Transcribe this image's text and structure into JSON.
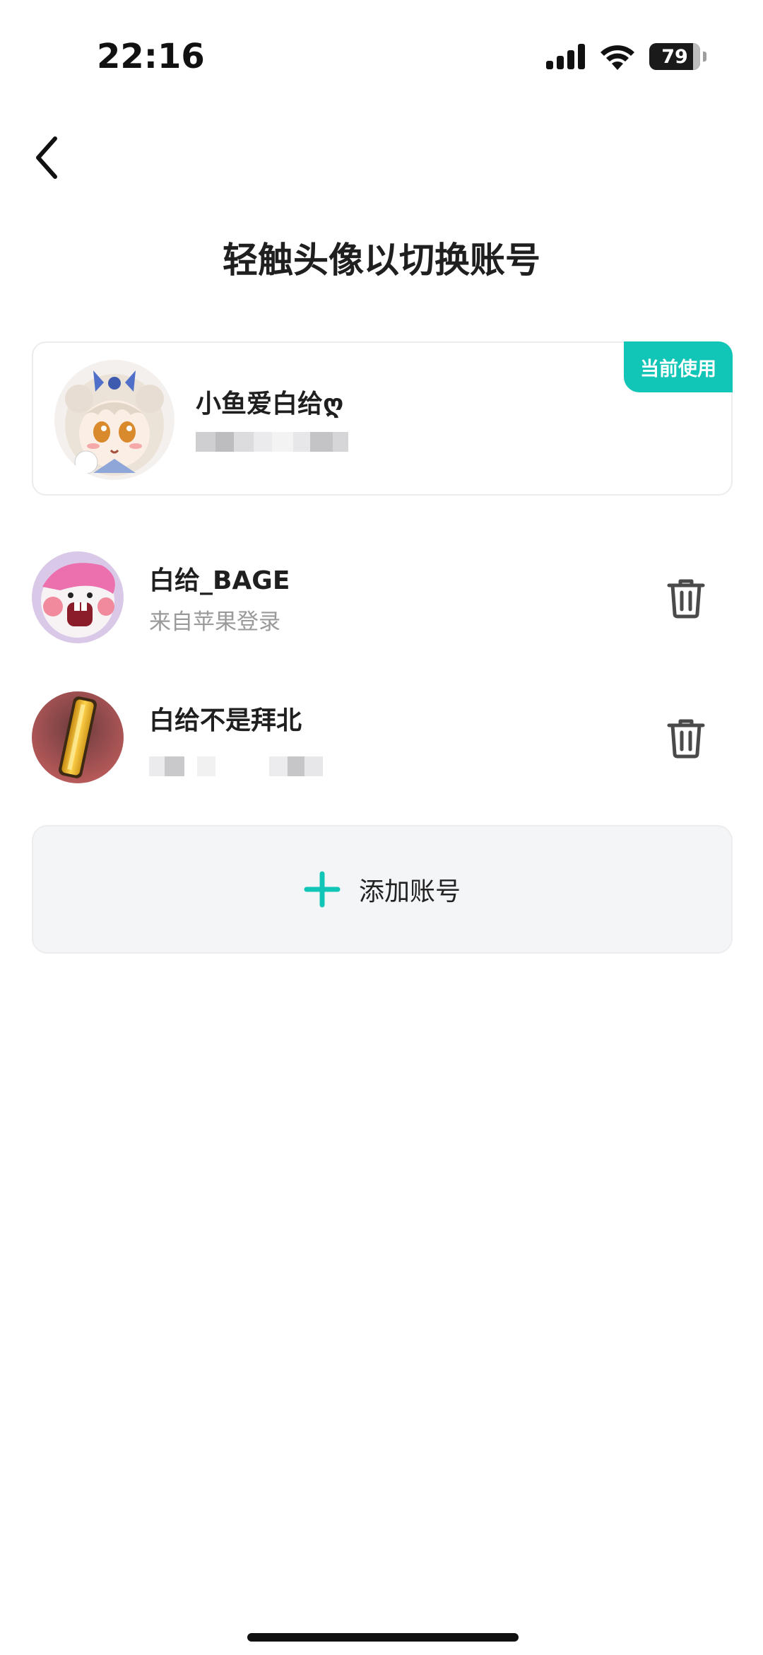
{
  "status_bar": {
    "time": "22:16",
    "battery": "79",
    "icons": [
      "cellular-signal-icon",
      "wifi-icon",
      "battery-icon"
    ]
  },
  "nav": {
    "back_icon": "chevron-left-icon"
  },
  "page": {
    "title": "轻触头像以切换账号"
  },
  "current_account": {
    "badge": "当前使用",
    "name": "小鱼爱白给ღ",
    "avatar_description_icon": "avatar-anime-girl",
    "detail_obscured": true
  },
  "accounts": [
    {
      "name": "白给_BAGE",
      "subtitle": "来自苹果登录",
      "avatar_icon": "avatar-pink-character",
      "action_icon": "trash-icon"
    },
    {
      "name": "白给不是拜北",
      "subtitle": "",
      "avatar_icon": "avatar-gold-bar",
      "action_icon": "trash-icon",
      "detail_obscured": true
    }
  ],
  "add_account": {
    "label": "添加账号",
    "icon": "plus-icon"
  },
  "colors": {
    "accent": "#12c6b7",
    "text_primary": "#1f1f1f",
    "text_secondary": "#9a9a9a",
    "add_bg": "#f4f5f7"
  }
}
